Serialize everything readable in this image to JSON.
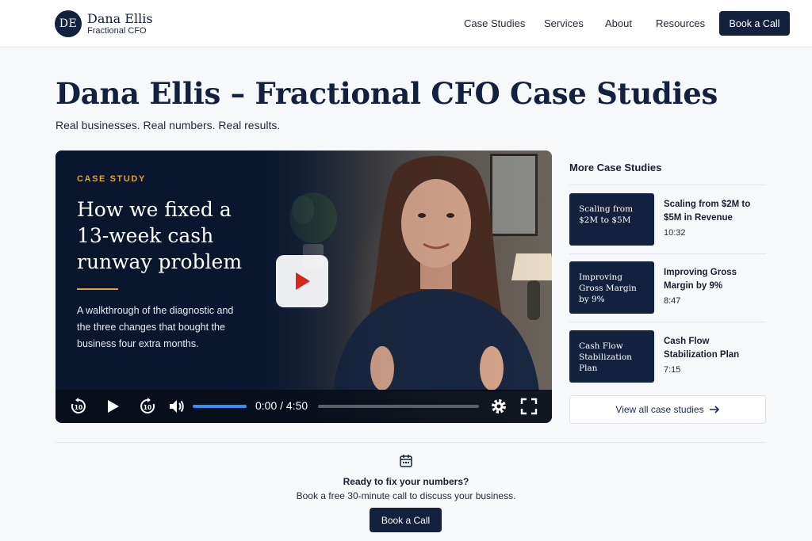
{
  "header": {
    "logo_initials": "DE",
    "logo_name": "Dana Ellis",
    "logo_subtitle": "Fractional CFO",
    "nav": [
      "Case Studies",
      "Services",
      "About",
      "Resources"
    ],
    "cta_label": "Book a Call"
  },
  "hero": {
    "title": "Dana Ellis – Fractional CFO Case Studies",
    "subtitle": "Real businesses. Real numbers. Real results."
  },
  "video": {
    "tag": "CASE STUDY",
    "title": "How we fixed a 13-week cash runway problem",
    "description": "A walkthrough of the diagnostic and the three changes that bought the business four extra months.",
    "time": "0:00 / 4:50",
    "progress": 0,
    "volume": 1.0,
    "icons": [
      "rewind-10-icon",
      "play-icon",
      "forward-10-icon",
      "volume-icon",
      "settings-icon",
      "fullscreen-icon"
    ]
  },
  "sidebar": {
    "title": "More Case Studies",
    "items": [
      {
        "thumb": "Scaling from $2M to $5M",
        "title": "Scaling from $2M to $5M in Revenue",
        "duration": "10:32"
      },
      {
        "thumb": "Improving Gross Margin by 9%",
        "title": "Improving Gross Margin by 9%",
        "duration": "8:47"
      },
      {
        "thumb": "Cash Flow Stabilization Plan",
        "title": "Cash Flow Stabilization Plan",
        "duration": "7:15"
      }
    ],
    "view_all": "View all case studies"
  },
  "cta": {
    "heading": "Ready to fix your numbers?",
    "text": "Book a free 30-minute call to discuss your business.",
    "button": "Book a Call",
    "icon": "calendar-icon"
  },
  "colors": {
    "navy": "#13203e",
    "accent": "#e0a040",
    "play_red": "#d9261c",
    "volume_blue": "#2f90ff"
  }
}
